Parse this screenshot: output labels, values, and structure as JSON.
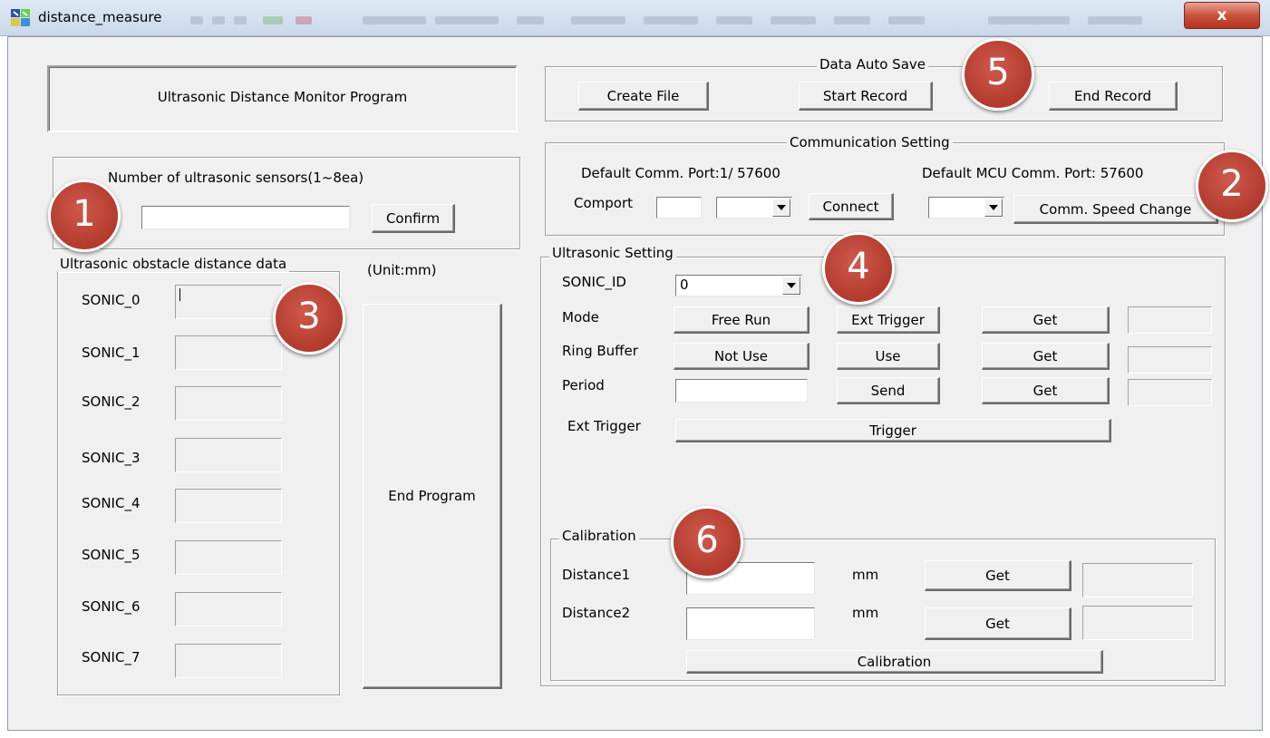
{
  "window": {
    "title": "distance_measure",
    "close_glyph": "x",
    "icon": "app-icon"
  },
  "banner": {
    "text": "Ultrasonic Distance Monitor Program"
  },
  "sensor_count": {
    "label": "Number of ultrasonic sensors(1~8ea)",
    "value": "",
    "confirm_label": "Confirm"
  },
  "distance_data": {
    "title": "Ultrasonic obstacle distance data",
    "unit": "(Unit:mm)",
    "sensors": [
      {
        "label": "SONIC_0",
        "value": ""
      },
      {
        "label": "SONIC_1",
        "value": ""
      },
      {
        "label": "SONIC_2",
        "value": ""
      },
      {
        "label": "SONIC_3",
        "value": ""
      },
      {
        "label": "SONIC_4",
        "value": ""
      },
      {
        "label": "SONIC_5",
        "value": ""
      },
      {
        "label": "SONIC_6",
        "value": ""
      },
      {
        "label": "SONIC_7",
        "value": ""
      }
    ]
  },
  "end_program_label": "End Program",
  "auto_save": {
    "title": "Data Auto Save",
    "create_file": "Create File",
    "start_record": "Start Record",
    "end_record": "End Record"
  },
  "comm": {
    "title": "Communication Setting",
    "default_port": "Default Comm. Port:1/ 57600",
    "default_mcu": "Default MCU Comm. Port: 57600",
    "comport_label": "Comport",
    "comport_value": "",
    "baud_value": "",
    "connect": "Connect",
    "mcu_speed_value": "",
    "speed_change": "Comm. Speed Change"
  },
  "ultra": {
    "title": "Ultrasonic Setting",
    "sonic_id_label": "SONIC_ID",
    "sonic_id_value": "0",
    "mode_label": "Mode",
    "free_run": "Free Run",
    "ext_trigger_btn": "Ext Trigger",
    "get": "Get",
    "ring_label": "Ring Buffer",
    "not_use": "Not Use",
    "use": "Use",
    "period_label": "Period",
    "period_value": "",
    "send": "Send",
    "ext_trigger_label": "Ext Trigger",
    "trigger": "Trigger"
  },
  "calib": {
    "title": "Calibration",
    "distance1_label": "Distance1",
    "distance2_label": "Distance2",
    "distance1_value": "",
    "distance2_value": "",
    "unit": "mm",
    "get": "Get",
    "calibration_btn": "Calibration"
  },
  "annotations": [
    "1",
    "2",
    "3",
    "4",
    "5",
    "6"
  ],
  "colors": {
    "badge": "#b33a2d",
    "dialog_bg": "#f0f0f0",
    "close_button": "#c8533c"
  }
}
